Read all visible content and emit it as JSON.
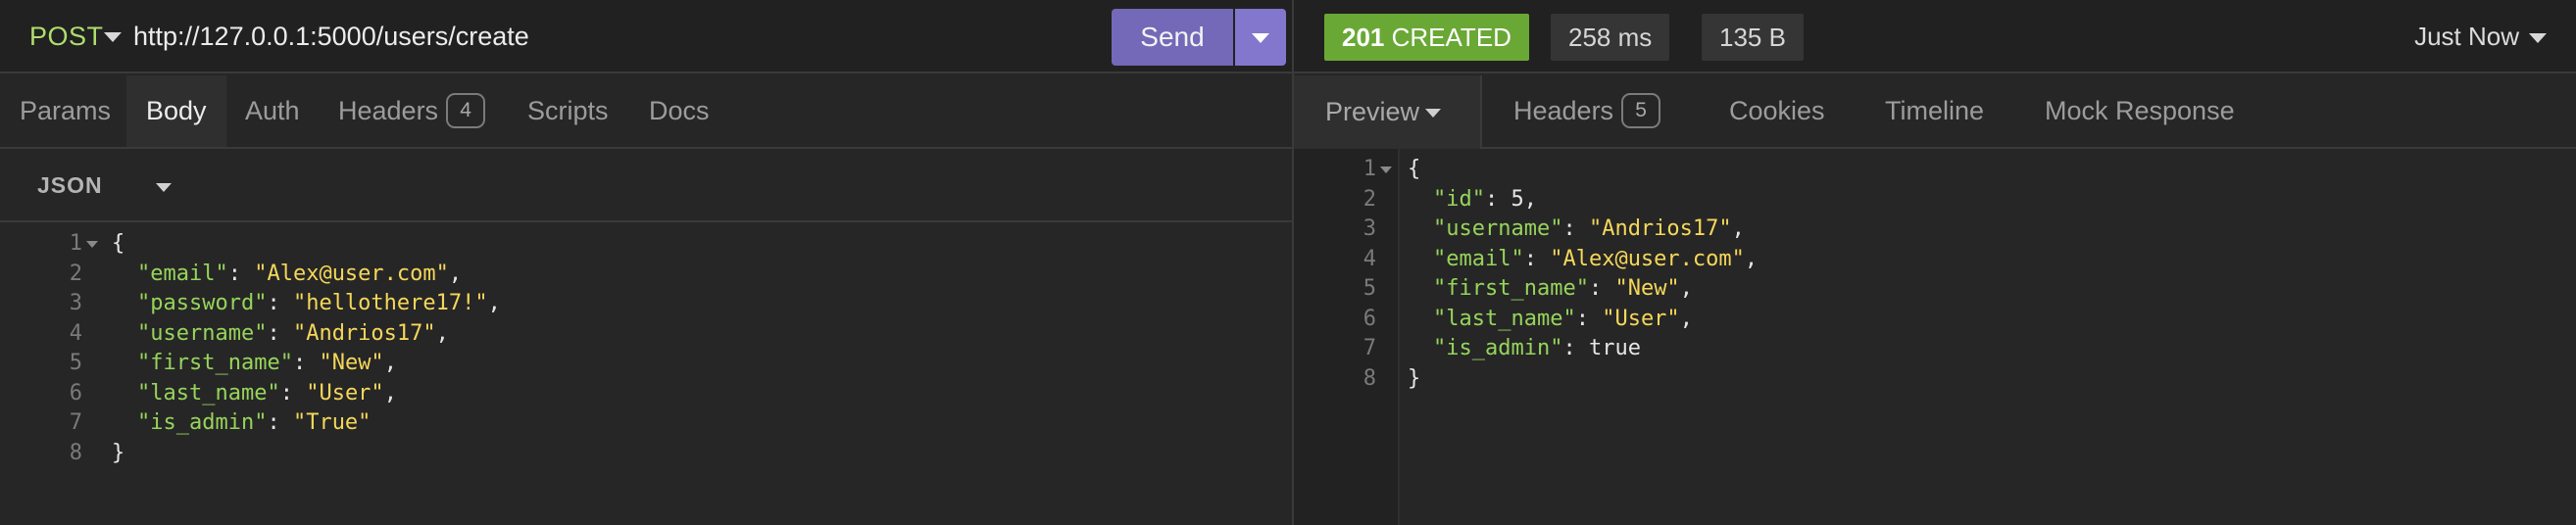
{
  "request": {
    "method": "POST",
    "url": "http://127.0.0.1:5000/users/create",
    "send_label": "Send",
    "tabs": [
      {
        "label": "Params"
      },
      {
        "label": "Body"
      },
      {
        "label": "Auth"
      },
      {
        "label": "Headers",
        "badge": "4"
      },
      {
        "label": "Scripts"
      },
      {
        "label": "Docs"
      }
    ],
    "body_format": "JSON",
    "body_lines": [
      {
        "n": "1",
        "text": "{"
      },
      {
        "n": "2",
        "key": "\"email\"",
        "value": "\"Alex@user.com\"",
        "comma": ","
      },
      {
        "n": "3",
        "key": "\"password\"",
        "value": "\"hellothere17!\"",
        "comma": ","
      },
      {
        "n": "4",
        "key": "\"username\"",
        "value": "\"Andrios17\"",
        "comma": ","
      },
      {
        "n": "5",
        "key": "\"first_name\"",
        "value": "\"New\"",
        "comma": ","
      },
      {
        "n": "6",
        "key": "\"last_name\"",
        "value": "\"User\"",
        "comma": ","
      },
      {
        "n": "7",
        "key": "\"is_admin\"",
        "value": "\"True\"",
        "comma": ""
      },
      {
        "n": "8",
        "text": "}"
      }
    ]
  },
  "response": {
    "status": "201",
    "status_text": "CREATED",
    "time": "258 ms",
    "size": "135 B",
    "history": "Just Now",
    "preview_label": "Preview",
    "tabs": [
      {
        "label": "Headers",
        "badge": "5"
      },
      {
        "label": "Cookies"
      },
      {
        "label": "Timeline"
      },
      {
        "label": "Mock Response"
      }
    ],
    "body_lines": [
      {
        "n": "1",
        "text": "{"
      },
      {
        "n": "2",
        "key": "\"id\"",
        "value": "5",
        "comma": ",",
        "plain": true
      },
      {
        "n": "3",
        "key": "\"username\"",
        "value": "\"Andrios17\"",
        "comma": ","
      },
      {
        "n": "4",
        "key": "\"email\"",
        "value": "\"Alex@user.com\"",
        "comma": ","
      },
      {
        "n": "5",
        "key": "\"first_name\"",
        "value": "\"New\"",
        "comma": ","
      },
      {
        "n": "6",
        "key": "\"last_name\"",
        "value": "\"User\"",
        "comma": ","
      },
      {
        "n": "7",
        "key": "\"is_admin\"",
        "value": "true",
        "comma": "",
        "plain": true
      },
      {
        "n": "8",
        "text": "}"
      }
    ]
  },
  "colors": {
    "method": "#aede6e",
    "send": "#7468b8",
    "status_ok": "#6aa836",
    "json_key": "#96d45b",
    "json_string": "#f5d75a"
  }
}
